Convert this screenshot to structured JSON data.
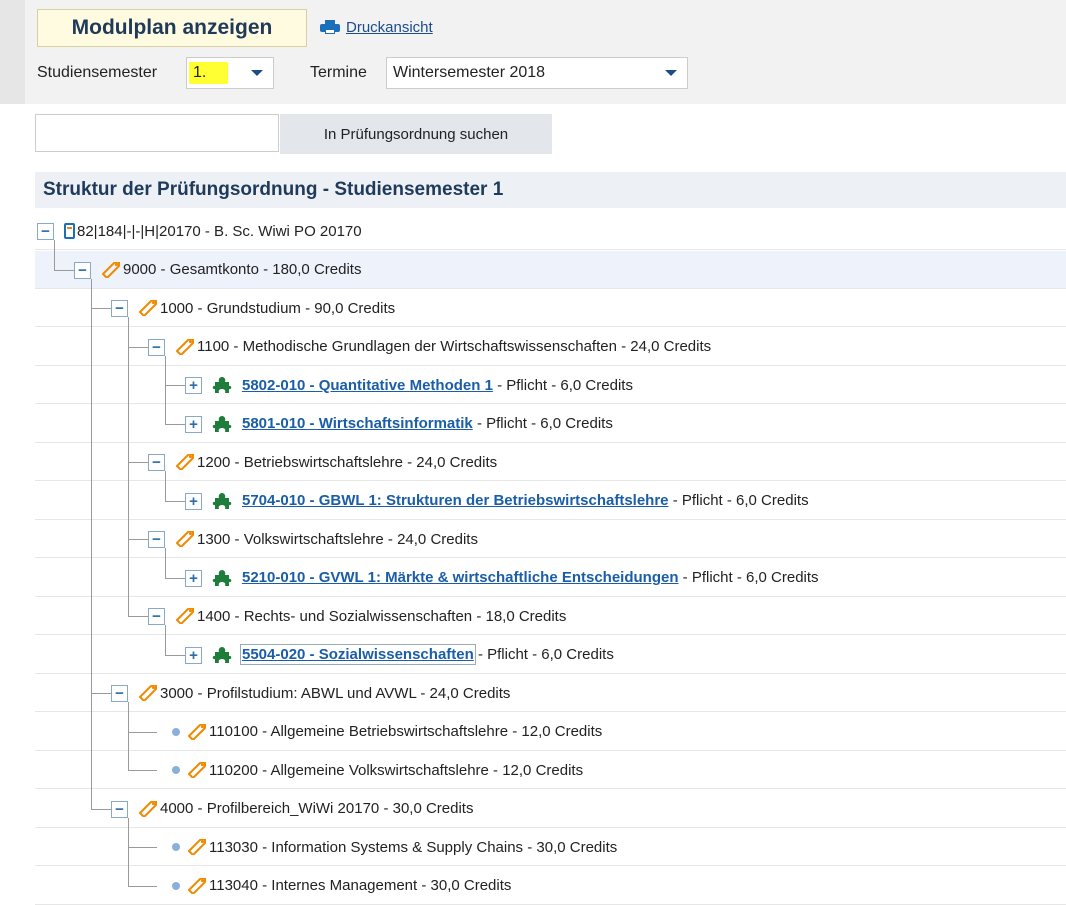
{
  "header": {
    "title": "Modulplan anzeigen",
    "print_label": "Druckansicht",
    "semester_label": "Studiensemester",
    "semester_value": "1.",
    "termine_label": "Termine",
    "termine_value": "Wintersemester 2018"
  },
  "search": {
    "value": "",
    "button_label": "In Prüfungsordnung suchen"
  },
  "section": {
    "title": "Struktur der Prüfungsordnung - Studiensemester 1"
  },
  "tree": [
    {
      "text": "82|184|-|-|H|20170 - B. Sc. Wiwi PO 20170"
    },
    {
      "text": "9000 - Gesamtkonto - 180,0 Credits"
    },
    {
      "text": "1000 - Grundstudium - 90,0 Credits"
    },
    {
      "text": "1100 - Methodische Grundlagen der Wirtschaftswissenschaften - 24,0 Credits"
    },
    {
      "link": "5802-010 - Quantitative Methoden 1",
      "suffix": " - Pflicht - 6,0 Credits"
    },
    {
      "link": "5801-010 - Wirtschaftsinformatik",
      "suffix": " - Pflicht - 6,0 Credits"
    },
    {
      "text": "1200 - Betriebswirtschaftslehre - 24,0 Credits"
    },
    {
      "link": "5704-010 - GBWL 1: Strukturen der Betriebswirtschaftslehre",
      "suffix": " - Pflicht - 6,0 Credits"
    },
    {
      "text": "1300 - Volkswirtschaftslehre - 24,0 Credits"
    },
    {
      "link": "5210-010 - GVWL 1: Märkte & wirtschaftliche Entscheidungen",
      "suffix": " - Pflicht - 6,0 Credits"
    },
    {
      "text": "1400 - Rechts- und Sozialwissenschaften - 18,0 Credits"
    },
    {
      "link": "5504-020 - Sozialwissenschaften",
      "suffix": " - Pflicht - 6,0 Credits"
    },
    {
      "text": "3000 - Profilstudium: ABWL und AVWL - 24,0 Credits"
    },
    {
      "text": "110100 - Allgemeine Betriebswirtschaftslehre - 12,0 Credits"
    },
    {
      "text": "110200 - Allgemeine Volkswirtschaftslehre - 12,0 Credits"
    },
    {
      "text": "4000 - Profilbereich_WiWi 20170 - 30,0 Credits"
    },
    {
      "text": "113030 - Information Systems & Supply Chains - 30,0 Credits"
    },
    {
      "text": "113040 - Internes Management - 30,0 Credits"
    }
  ],
  "toggles": {
    "expanded": "−",
    "collapsed": "+"
  },
  "colors": {
    "accent": "#1a5da8",
    "highlight": "#ffff33",
    "tag": "#f08a00",
    "puzzle": "#1e7d3a"
  },
  "icons": {
    "root": "root-node-icon",
    "tag": "tag-icon",
    "puzzle": "puzzle-icon",
    "leaf": "leaf-dot-icon",
    "print": "printer-icon"
  }
}
